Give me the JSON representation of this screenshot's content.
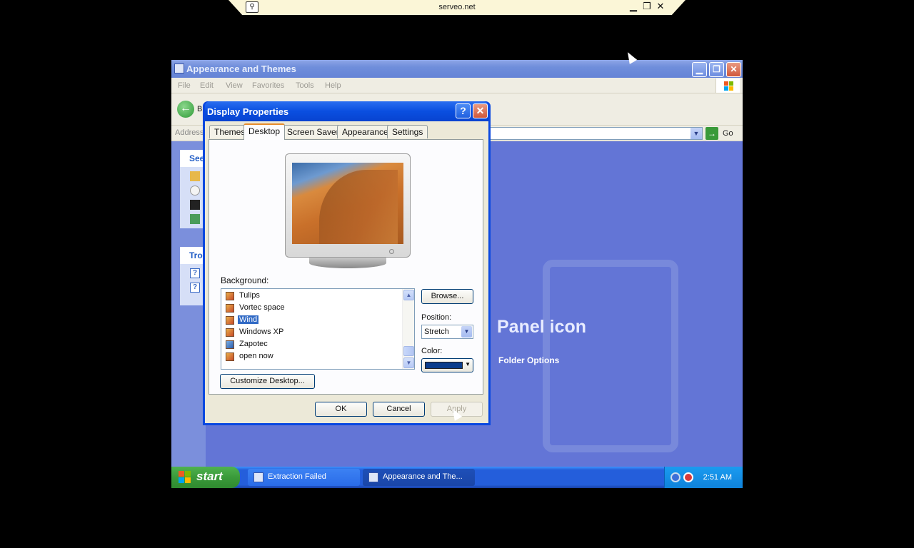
{
  "remote": {
    "host": "serveo.net",
    "min": "▁",
    "restore": "❐",
    "close": "✕"
  },
  "window": {
    "title": "Appearance and Themes",
    "menu": [
      "File",
      "Edit",
      "View",
      "Favorites",
      "Tools",
      "Help"
    ],
    "back_label": "B",
    "address_label": "Address",
    "go_label": "Go",
    "panel1_head": "See",
    "panel2_head": "Tro",
    "big_text": "Panel icon",
    "link_text": "Folder Options"
  },
  "dialog": {
    "title": "Display Properties",
    "help": "?",
    "close": "✕",
    "tabs": [
      "Themes",
      "Desktop",
      "Screen Saver",
      "Appearance",
      "Settings"
    ],
    "active_tab": "Desktop",
    "background_label": "Background:",
    "backgrounds": [
      "Tulips",
      "Vortec space",
      "Wind",
      "Windows XP",
      "Zapotec",
      "open now"
    ],
    "selected_background": "Wind",
    "browse": "Browse...",
    "position_label": "Position:",
    "position_value": "Stretch",
    "color_label": "Color:",
    "color_value": "#0a3c8c",
    "customize": "Customize Desktop...",
    "ok": "OK",
    "cancel": "Cancel",
    "apply": "Apply"
  },
  "taskbar": {
    "start": "start",
    "tasks": [
      "Extraction Failed",
      "Appearance and The..."
    ],
    "clock": "2:51 AM"
  }
}
